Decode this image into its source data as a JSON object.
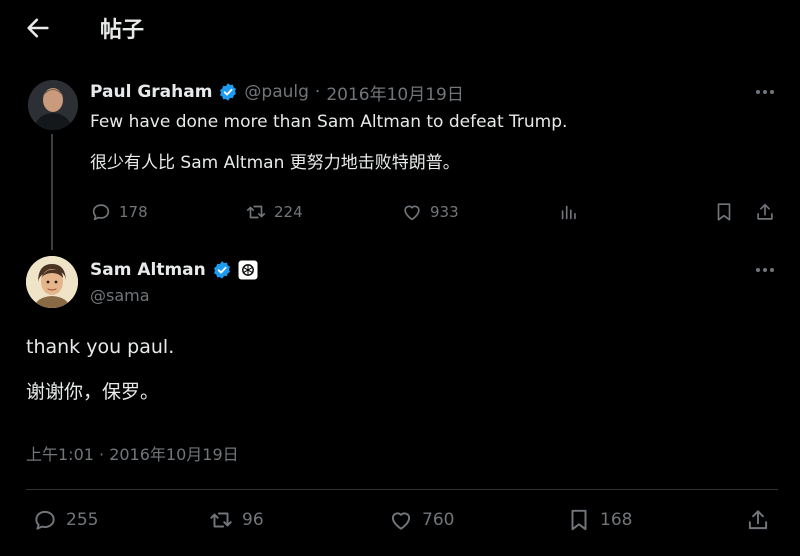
{
  "header": {
    "title": "帖子",
    "back_icon": "arrow-left-icon"
  },
  "parent_tweet": {
    "author_name": "Paul Graham",
    "handle": "@paulg",
    "separator": "·",
    "date": "2016年10月19日",
    "text_en": "Few have done more than Sam Altman to defeat Trump.",
    "text_zh": "很少有人比 Sam Altman 更努力地击败特朗普。",
    "replies": "178",
    "retweets": "224",
    "likes": "933"
  },
  "reply_tweet": {
    "author_name": "Sam Altman",
    "handle": "@sama",
    "text_en": "thank you paul.",
    "text_zh": "谢谢你，保罗。",
    "timestamp": "上午1:01 · 2016年10月19日",
    "replies": "255",
    "retweets": "96",
    "likes": "760",
    "bookmarks": "168"
  },
  "colors": {
    "background": "#000000",
    "text": "#e7e9ea",
    "muted": "#71767b",
    "verified": "#1d9bf0",
    "separator": "#2f3336"
  }
}
